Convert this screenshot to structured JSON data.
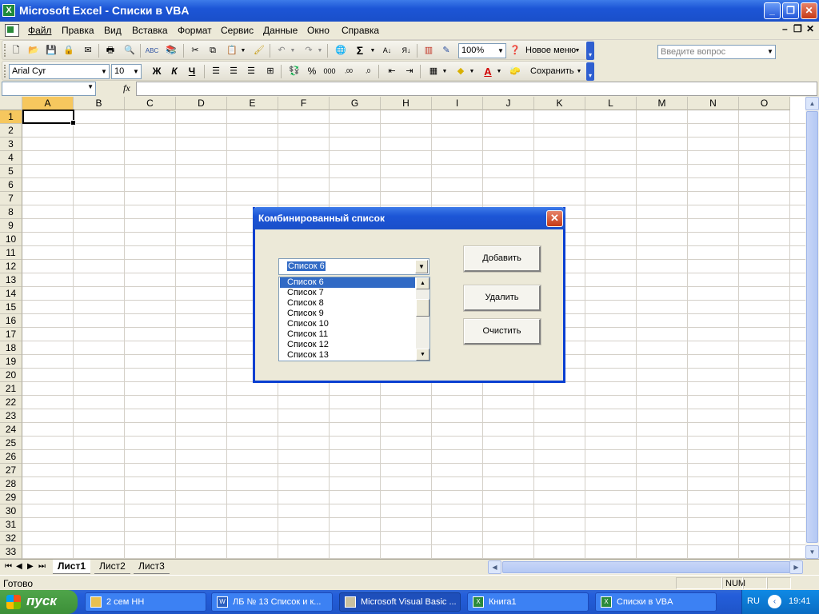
{
  "window": {
    "title": "Microsoft Excel - Списки в VBA"
  },
  "menu": [
    "Файл",
    "Правка",
    "Вид",
    "Вставка",
    "Формат",
    "Сервис",
    "Данные",
    "Окно",
    "Справка"
  ],
  "help": {
    "placeholder": "Введите вопрос"
  },
  "standard_toolbar": {
    "zoom": "100%",
    "new_menu": "Новое меню"
  },
  "format_toolbar": {
    "font": "Arial Cyr",
    "size": "10",
    "bold": "Ж",
    "italic": "К",
    "underline": "Ч",
    "save": "Сохранить"
  },
  "formula_bar": {
    "fx": "fx"
  },
  "columns": [
    "A",
    "B",
    "C",
    "D",
    "E",
    "F",
    "G",
    "H",
    "I",
    "J",
    "K",
    "L",
    "M",
    "N",
    "O"
  ],
  "rows": [
    "1",
    "2",
    "3",
    "4",
    "5",
    "6",
    "7",
    "8",
    "9",
    "10",
    "11",
    "12",
    "13",
    "14",
    "15",
    "16",
    "17",
    "18",
    "19",
    "20",
    "21",
    "22",
    "23",
    "24",
    "25",
    "26",
    "27",
    "28",
    "29",
    "30",
    "31",
    "32",
    "33"
  ],
  "sheets": [
    "Лист1",
    "Лист2",
    "Лист3"
  ],
  "status": {
    "text": "Готово",
    "num": "NUM"
  },
  "dialog": {
    "title": "Комбинированный список",
    "combo_value": "Список  6",
    "list_items": [
      "Список  6",
      "Список  7",
      "Список  8",
      "Список  9",
      "Список  10",
      "Список  11",
      "Список  12",
      "Список  13"
    ],
    "buttons": {
      "add": "Добавить",
      "delete": "Удалить",
      "clear": "Очистить"
    }
  },
  "taskbar": {
    "start": "пуск",
    "tasks": [
      "2 сем НН",
      "ЛБ № 13 Список и к...",
      "Microsoft Visual Basic ...",
      "Книга1",
      "Списки в VBA"
    ],
    "lang": "RU",
    "clock": "19:41"
  }
}
